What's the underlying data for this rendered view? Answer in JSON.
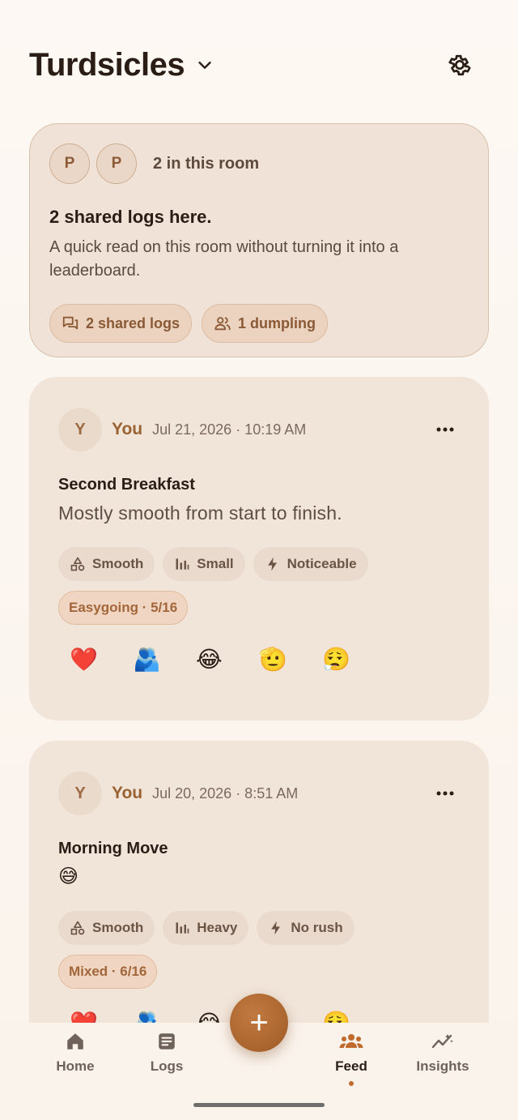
{
  "header": {
    "room_name": "Turdsicles"
  },
  "summary": {
    "members": [
      {
        "initial": "P"
      },
      {
        "initial": "P"
      }
    ],
    "members_count": "2 in this room",
    "heading": "2 shared logs here.",
    "description": "A quick read on this room without turning it into a leaderboard.",
    "pills": [
      {
        "label": "2 shared logs",
        "icon": "chat-bubbles-icon"
      },
      {
        "label": "1 dumpling",
        "icon": "people-icon"
      }
    ]
  },
  "posts": [
    {
      "avatar": "Y",
      "author": "You",
      "date": "Jul 21, 2026 · 10:19 AM",
      "title": "Second Breakfast",
      "body": "Mostly smooth from start to finish.",
      "tags": [
        {
          "label": "Smooth",
          "icon": "shapes-icon"
        },
        {
          "label": "Small",
          "icon": "bars-icon"
        },
        {
          "label": "Noticeable",
          "icon": "bolt-icon"
        }
      ],
      "mood": "Easygoing · 5/16",
      "reactions": [
        "❤️",
        "🫂",
        "😂",
        "🫡",
        "😮‍💨"
      ]
    },
    {
      "avatar": "Y",
      "author": "You",
      "date": "Jul 20, 2026 · 8:51 AM",
      "title": "Morning Move",
      "body": "😅",
      "tags": [
        {
          "label": "Smooth",
          "icon": "shapes-icon"
        },
        {
          "label": "Heavy",
          "icon": "bars-icon"
        },
        {
          "label": "No rush",
          "icon": "bolt-icon"
        }
      ],
      "mood": "Mixed · 6/16",
      "reactions": [
        "❤️",
        "🫂",
        "😂",
        "🫡",
        "😮‍💨"
      ]
    }
  ],
  "nav": {
    "items": [
      {
        "label": "Home",
        "icon": "home-icon"
      },
      {
        "label": "Logs",
        "icon": "document-icon"
      },
      {
        "label": "Feed",
        "icon": "group-icon",
        "active": true
      },
      {
        "label": "Insights",
        "icon": "trend-icon"
      }
    ],
    "fab_label": "+"
  },
  "colors": {
    "accent": "#9a6131",
    "fab": "#b06a32",
    "card_bg": "#f1e5da"
  }
}
